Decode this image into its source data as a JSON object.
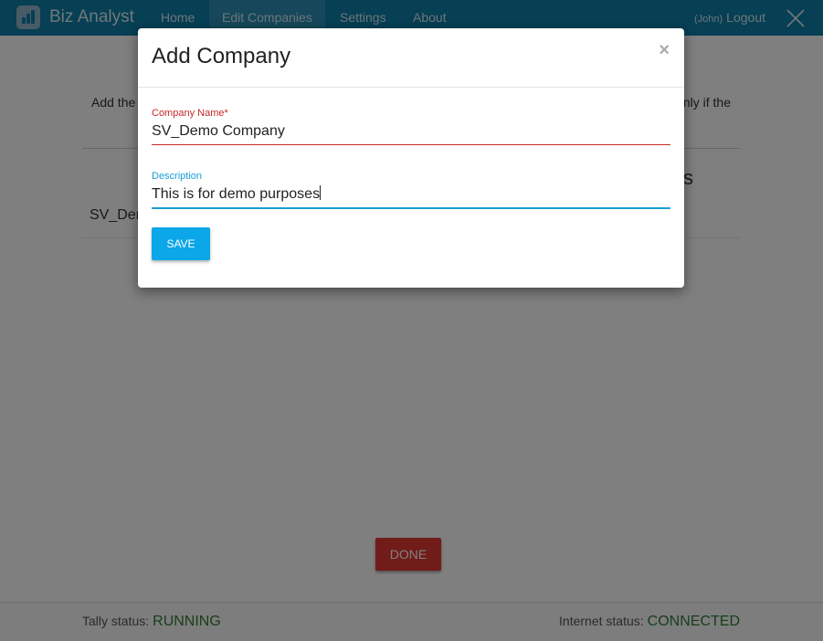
{
  "app": {
    "name": "Biz Analyst"
  },
  "nav": {
    "items": [
      {
        "label": "Home"
      },
      {
        "label": "Edit Companies"
      },
      {
        "label": "Settings"
      },
      {
        "label": "About"
      }
    ],
    "active_index": 1,
    "user": "(John)",
    "logout_label": "Logout",
    "close_icon": "close-icon"
  },
  "page": {
    "intro_left": "Add the",
    "intro_right": "nly if the",
    "column_header_tail": "s",
    "company_row": "SV_Der",
    "done_label": "DONE"
  },
  "modal": {
    "title": "Add Company",
    "close_glyph": "×",
    "company_name": {
      "label": "Company Name*",
      "value": "SV_Demo Company"
    },
    "description": {
      "label": "Description",
      "value": "This is for demo purposes"
    },
    "save_label": "SAVE"
  },
  "footer": {
    "tally_label": "Tally status:",
    "tally_value": "RUNNING",
    "internet_label": "Internet status:",
    "internet_value": "CONNECTED"
  },
  "colors": {
    "navbar": "#0f7ea8",
    "active_tab": "#2c8fb5",
    "required_red": "#c62828",
    "focus_blue": "#1a9fd6",
    "save_button": "#0ba7e8",
    "done_button": "#e53935",
    "status_green": "#2e7d32"
  }
}
